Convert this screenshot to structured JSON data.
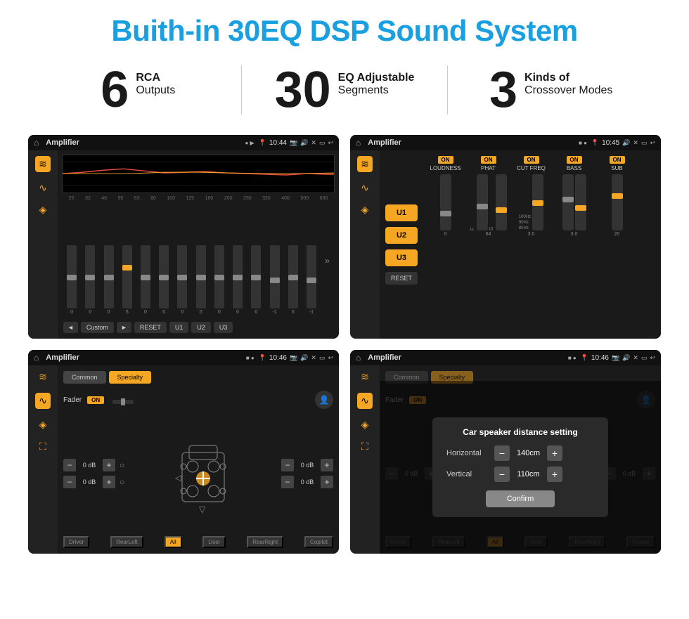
{
  "page": {
    "title": "Buith-in 30EQ DSP Sound System",
    "stats": [
      {
        "number": "6",
        "label_top": "RCA",
        "label_bottom": "Outputs"
      },
      {
        "number": "30",
        "label_top": "EQ Adjustable",
        "label_bottom": "Segments"
      },
      {
        "number": "3",
        "label_top": "Kinds of",
        "label_bottom": "Crossover Modes"
      }
    ],
    "screens": [
      {
        "id": "eq-screen",
        "app_name": "Amplifier",
        "time": "10:44",
        "type": "eq",
        "bands": [
          "25",
          "32",
          "40",
          "50",
          "63",
          "80",
          "100",
          "125",
          "160",
          "200",
          "250",
          "320",
          "400",
          "500",
          "630"
        ],
        "values": [
          "0",
          "0",
          "0",
          "5",
          "0",
          "0",
          "0",
          "0",
          "0",
          "0",
          "0",
          "-1",
          "0",
          "-1"
        ],
        "bottom_buttons": [
          "◄",
          "Custom",
          "►",
          "RESET",
          "U1",
          "U2",
          "U3"
        ]
      },
      {
        "id": "crossover-screen",
        "app_name": "Amplifier",
        "time": "10:45",
        "type": "crossover",
        "u_buttons": [
          "U1",
          "U2",
          "U3"
        ],
        "groups": [
          {
            "label": "LOUDNESS",
            "on": true
          },
          {
            "label": "PHAT",
            "on": true
          },
          {
            "label": "CUT FREQ",
            "on": true
          },
          {
            "label": "BASS",
            "on": true
          },
          {
            "label": "SUB",
            "on": true
          }
        ],
        "reset_label": "RESET"
      },
      {
        "id": "fader-screen",
        "app_name": "Amplifier",
        "time": "10:46",
        "type": "fader",
        "tabs": [
          "Common",
          "Specialty"
        ],
        "active_tab": "Specialty",
        "fader_label": "Fader",
        "fader_on": "ON",
        "db_values": [
          "0 dB",
          "0 dB",
          "0 dB",
          "0 dB"
        ],
        "bottom_labels": [
          "Driver",
          "RearLeft",
          "All",
          "User",
          "RearRight",
          "Copilot"
        ]
      },
      {
        "id": "distance-screen",
        "app_name": "Amplifier",
        "time": "10:46",
        "type": "fader-dialog",
        "tabs": [
          "Common",
          "Specialty"
        ],
        "active_tab": "Specialty",
        "dialog": {
          "title": "Car speaker distance setting",
          "horizontal_label": "Horizontal",
          "horizontal_value": "140cm",
          "vertical_label": "Vertical",
          "vertical_value": "110cm",
          "confirm_label": "Confirm"
        },
        "db_values": [
          "0 dB",
          "0 dB"
        ],
        "bottom_labels": [
          "Driver",
          "RearLeft",
          "All",
          "User",
          "RearRight",
          "Copilot"
        ]
      }
    ]
  }
}
